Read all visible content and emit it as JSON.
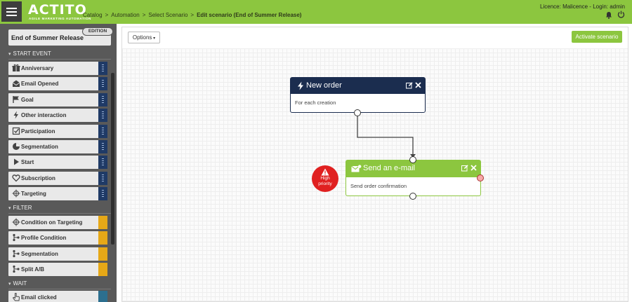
{
  "header": {
    "logo": "ACTITO",
    "logo_tagline": "AGILE MARKETING AUTOMATION",
    "breadcrumb": [
      "Catalog",
      "Automation",
      "Select Scenario",
      "Edit scenario (End of Summer Release)"
    ],
    "licence": "Licence: Malicence - Login: admin",
    "accent_color": "#8cc63f"
  },
  "sidebar": {
    "scenario_title": "End of Summer Release",
    "edition_badge": "EDITION",
    "sections": [
      {
        "label": "START EVENT",
        "items": [
          {
            "label": "Anniversary",
            "icon": "gift-icon"
          },
          {
            "label": "Email Opened",
            "icon": "envelope-open-icon"
          },
          {
            "label": "Goal",
            "icon": "flag-icon"
          },
          {
            "label": "Other interaction",
            "icon": "bolt-icon"
          },
          {
            "label": "Participation",
            "icon": "checkbox-icon"
          },
          {
            "label": "Segmentation",
            "icon": "pie-chart-icon"
          },
          {
            "label": "Start",
            "icon": "play-icon"
          },
          {
            "label": "Subscription",
            "icon": "heart-icon"
          },
          {
            "label": "Targeting",
            "icon": "crosshair-icon"
          }
        ]
      },
      {
        "label": "FILTER",
        "items": [
          {
            "label": "Condition on Targeting",
            "icon": "crosshair-icon"
          },
          {
            "label": "Profile Condition",
            "icon": "branch-icon"
          },
          {
            "label": "Segmentation",
            "icon": "branch-icon"
          },
          {
            "label": "Split A/B",
            "icon": "branch-icon"
          }
        ]
      },
      {
        "label": "WAIT",
        "items": [
          {
            "label": "Email clicked",
            "icon": "pointer-icon"
          }
        ]
      }
    ]
  },
  "toolbar": {
    "options_label": "Options",
    "activate_label": "Activate scenario"
  },
  "canvas": {
    "nodes": [
      {
        "title": "New order",
        "subtitle": "For each creation",
        "icon": "bolt-icon",
        "color": "#1b2d4f"
      },
      {
        "title": "Send an e-mail",
        "subtitle": "Send order confirmation",
        "icon": "envelope-icon",
        "color": "#8cc63f"
      }
    ],
    "priority_badge": {
      "line1": "High",
      "line2": "priority",
      "color": "#e02020"
    }
  }
}
